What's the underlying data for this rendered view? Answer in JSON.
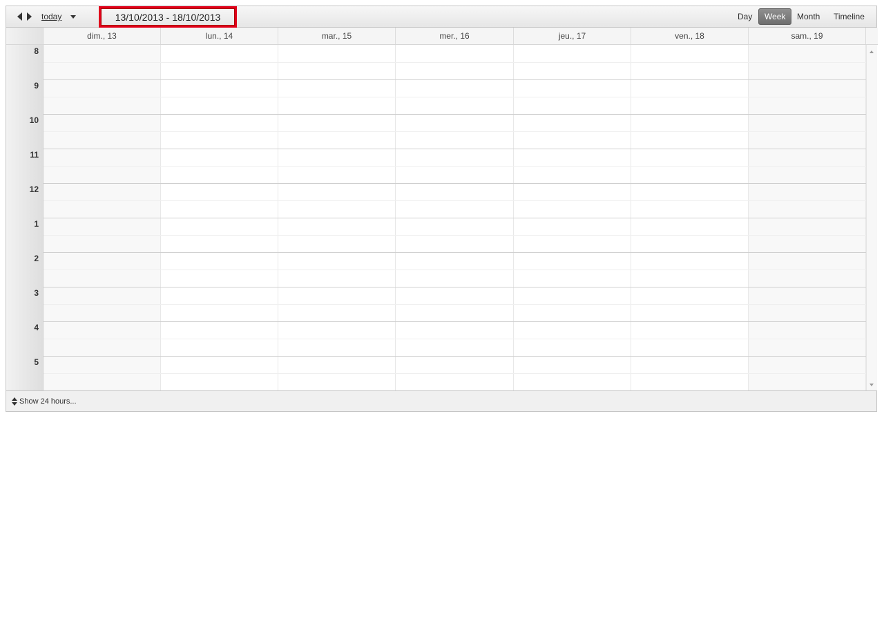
{
  "toolbar": {
    "today_label": "today",
    "date_range": "13/10/2013 - 18/10/2013",
    "views": [
      {
        "label": "Day",
        "selected": false
      },
      {
        "label": "Week",
        "selected": true
      },
      {
        "label": "Month",
        "selected": false
      },
      {
        "label": "Timeline",
        "selected": false
      }
    ],
    "highlight_color": "#e0001a"
  },
  "days": [
    "dim., 13",
    "lun., 14",
    "mar., 15",
    "mer., 16",
    "jeu., 17",
    "ven., 18",
    "sam., 19"
  ],
  "hours": [
    "8",
    "9",
    "10",
    "11",
    "12",
    "1",
    "2",
    "3",
    "4",
    "5"
  ],
  "footer": {
    "show_hours_label": "Show 24 hours..."
  }
}
